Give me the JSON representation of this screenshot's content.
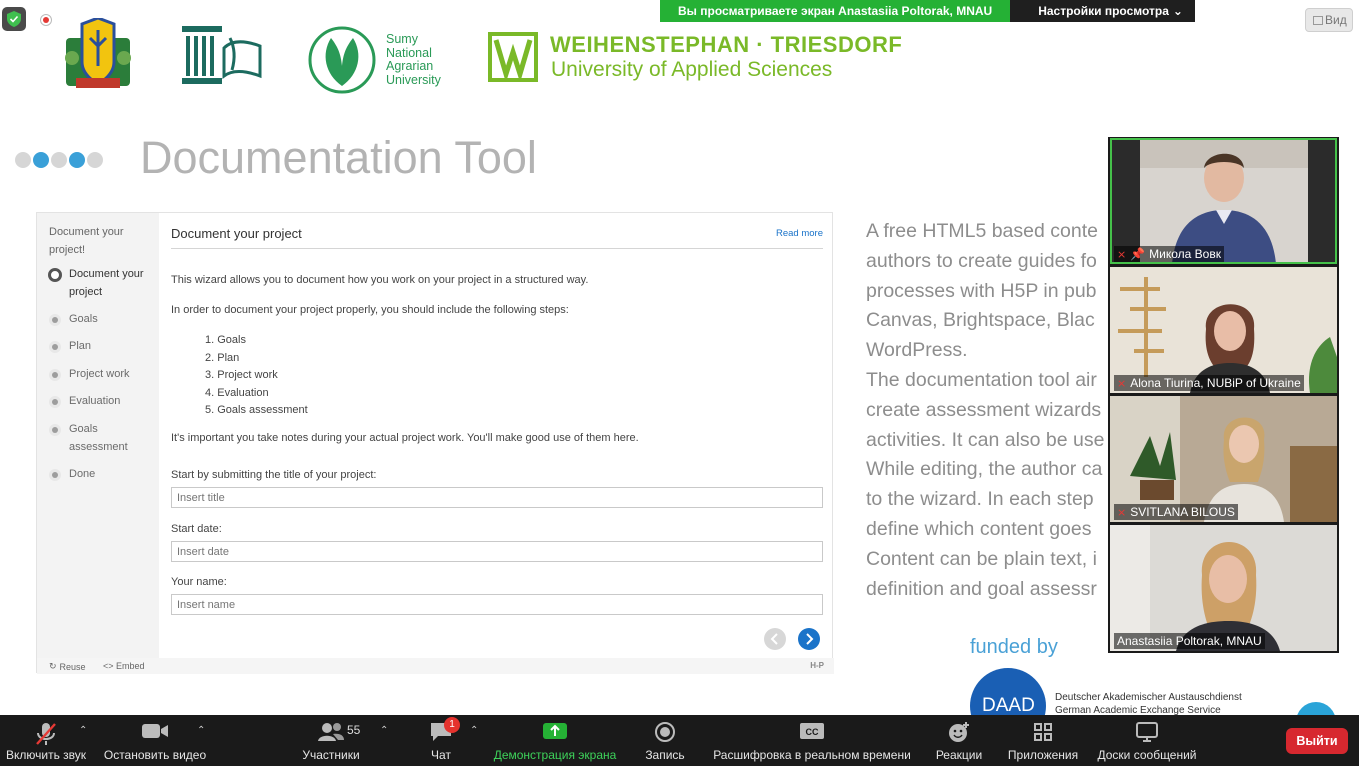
{
  "banner": {
    "message": "Вы просматриваете экран Anastasiia Poltorak, MNAU",
    "options_label": "Настройки просмотра"
  },
  "view_button": "Вид",
  "logos": {
    "snau_lines": [
      "Sumy",
      "National",
      "Agrarian",
      "University"
    ],
    "ws_title": "WEIHENSTEPHAN · TRIESDORF",
    "ws_subtitle": "University of Applied Sciences"
  },
  "slide": {
    "title": "Documentation Tool",
    "description_lines": [
      "A free HTML5 based conte",
      "authors to create guides fo",
      "processes with H5P in pub",
      "Canvas, Brightspace, Blac",
      "WordPress.",
      "The documentation tool air",
      "create assessment wizards",
      "activities. It can also be use",
      "While editing, the author ca",
      "to the wizard. In each step",
      "define which content goes",
      "Content can be plain text, i",
      "definition and goal assessr"
    ],
    "funded_by": "funded by",
    "daad": {
      "logo": "DAAD",
      "line1": "Deutscher Akademischer Austauschdienst",
      "line2": "German Academic Exchange Service"
    }
  },
  "h5p": {
    "sidebar_heading": [
      "Document your",
      "project!"
    ],
    "steps": [
      {
        "lines": [
          "Document your",
          "project"
        ],
        "active": true
      },
      {
        "lines": [
          "Goals"
        ],
        "active": false
      },
      {
        "lines": [
          "Plan"
        ],
        "active": false
      },
      {
        "lines": [
          "Project work"
        ],
        "active": false
      },
      {
        "lines": [
          "Evaluation"
        ],
        "active": false
      },
      {
        "lines": [
          "Goals",
          "assessment"
        ],
        "active": false
      },
      {
        "lines": [
          "Done"
        ],
        "active": false
      }
    ],
    "title": "Document your project",
    "read_more": "Read more",
    "intro": "This wizard allows you to document how you work on your project in a structured way.",
    "steps_intro": "In order to document your project properly, you should include the following steps:",
    "list": [
      "1. Goals",
      "2. Plan",
      "3. Project work",
      "4. Evaluation",
      "5. Goals assessment"
    ],
    "notes": "It's important you take notes during your actual project work. You'll make good use of them here.",
    "fields": [
      {
        "label": "Start by submitting the title of your project:",
        "placeholder": "Insert title"
      },
      {
        "label": "Start date:",
        "placeholder": "Insert date"
      },
      {
        "label": "Your name:",
        "placeholder": "Insert name"
      }
    ],
    "footer": {
      "reuse": "Reuse",
      "embed": "<> Embed",
      "logo": "H-P"
    }
  },
  "participants": [
    {
      "name": "Микола Вовк",
      "muted": true,
      "pinned": true,
      "speaking": true
    },
    {
      "name": "Alona Tiurina, NUBiP of Ukraine",
      "muted": true,
      "pinned": false,
      "speaking": false
    },
    {
      "name": "SVITLANA BILOUS",
      "muted": true,
      "pinned": false,
      "speaking": false
    },
    {
      "name": "Anastasiia Poltorak, MNAU",
      "muted": false,
      "pinned": false,
      "speaking": false
    }
  ],
  "toolbar": {
    "audio": "Включить звук",
    "video": "Остановить видео",
    "participants": "Участники",
    "participants_count": "55",
    "chat": "Чат",
    "chat_badge": "1",
    "share": "Демонстрация экрана",
    "record": "Запись",
    "captions": "Расшифровка в реальном времени",
    "reactions": "Реакции",
    "apps": "Приложения",
    "whiteboards": "Доски сообщений",
    "leave": "Выйти"
  },
  "colors": {
    "zoom_green": "#25b135",
    "ws_green": "#7ab928",
    "snau_green": "#2a9a57",
    "h5p_blue": "#1a73c9",
    "daad_blue": "#1a5fb4",
    "leave_red": "#d7282f"
  }
}
